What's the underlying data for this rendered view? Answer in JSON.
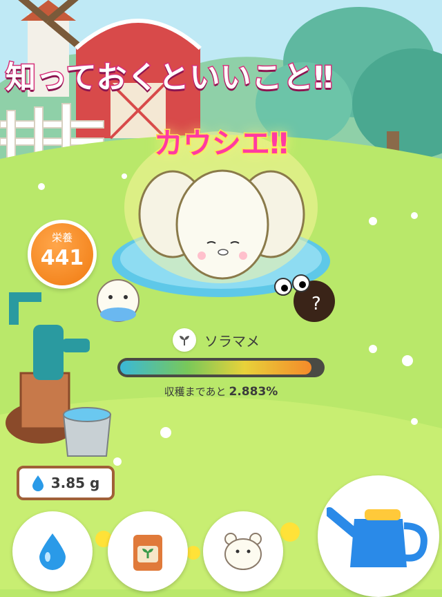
{
  "banner": {
    "line1": "知っておくといいこと‼",
    "line2": "カウシエ‼"
  },
  "stats": {
    "nutrition_label": "栄養",
    "nutrition_value": "441"
  },
  "plant": {
    "name": "ソラマメ",
    "harvest_label": "収穫まであと",
    "harvest_percent": "2.883%",
    "progress_fraction": 0.95
  },
  "water": {
    "amount": "3.85 g"
  },
  "toolbar": {
    "icons": [
      "water-drop-icon",
      "seed-bag-icon",
      "hamster-icon",
      "watering-can-icon"
    ]
  },
  "colors": {
    "accent_pink": "#d6307a",
    "nutrient_orange": "#f07a10",
    "grass": "#b9e86a",
    "sky": "#bfe9f5"
  }
}
